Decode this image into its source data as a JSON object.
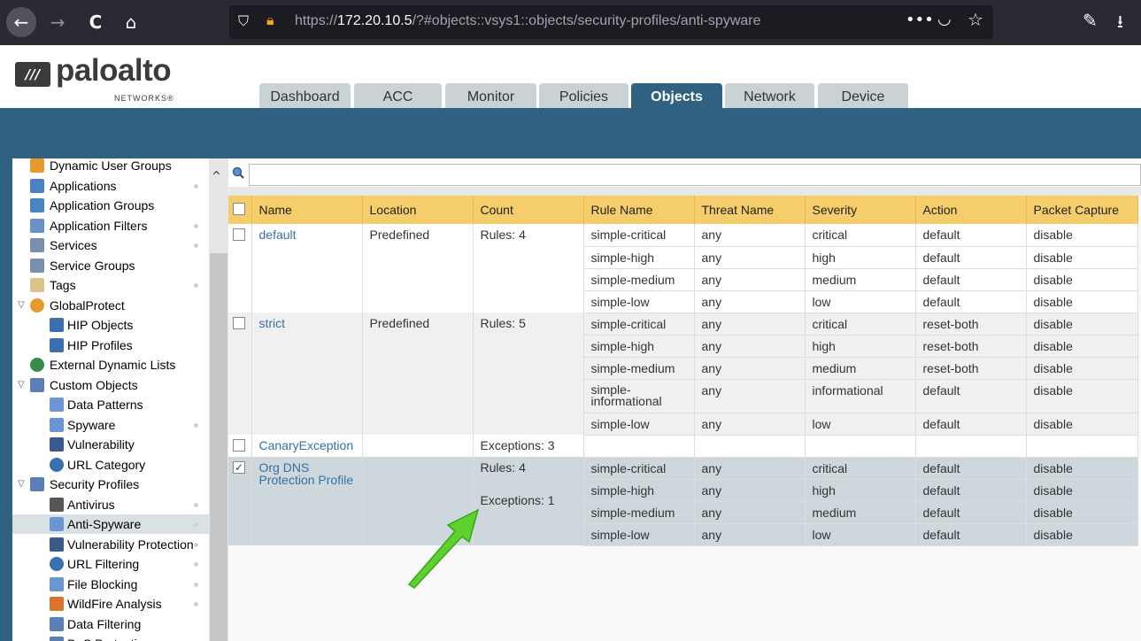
{
  "browser": {
    "back": "←",
    "forward": "→",
    "reload": "C",
    "home": "⌂",
    "url_prefix": "https://",
    "url_host": "172.20.10.5",
    "url_path": "/?#objects::vsys1::objects/security-profiles/anti-spyware",
    "more": "•••",
    "icons": [
      "back-icon",
      "forward-icon",
      "reload-icon",
      "home-icon",
      "shield-icon",
      "lock-icon",
      "pocket-icon",
      "star-icon",
      "wrench-icon",
      "download-icon"
    ]
  },
  "app": {
    "logo_text": "paloalto",
    "logo_sub": "NETWORKS®",
    "tabs": [
      "Dashboard",
      "ACC",
      "Monitor",
      "Policies",
      "Objects",
      "Network",
      "Device"
    ],
    "active_tab": "Objects"
  },
  "sidebar": {
    "items": [
      {
        "label": "Dynamic User Groups"
      },
      {
        "label": "Applications"
      },
      {
        "label": "Application Groups"
      },
      {
        "label": "Application Filters"
      },
      {
        "label": "Services"
      },
      {
        "label": "Service Groups"
      },
      {
        "label": "Tags"
      },
      {
        "label": "GlobalProtect"
      },
      {
        "label": "HIP Objects"
      },
      {
        "label": "HIP Profiles"
      },
      {
        "label": "External Dynamic Lists"
      },
      {
        "label": "Custom Objects"
      },
      {
        "label": "Data Patterns"
      },
      {
        "label": "Spyware"
      },
      {
        "label": "Vulnerability"
      },
      {
        "label": "URL Category"
      },
      {
        "label": "Security Profiles"
      },
      {
        "label": "Antivirus"
      },
      {
        "label": "Anti-Spyware"
      },
      {
        "label": "Vulnerability Protection"
      },
      {
        "label": "URL Filtering"
      },
      {
        "label": "File Blocking"
      },
      {
        "label": "WildFire Analysis"
      },
      {
        "label": "Data Filtering"
      },
      {
        "label": "DoS Protection"
      }
    ],
    "selected": "Anti-Spyware"
  },
  "table": {
    "columns": [
      "Name",
      "Location",
      "Count",
      "Rule Name",
      "Threat Name",
      "Severity",
      "Action",
      "Packet Capture"
    ],
    "profiles": [
      {
        "name": "default",
        "location": "Predefined",
        "count": [
          "Rules: 4"
        ],
        "checked": false,
        "rules": [
          [
            "simple-critical",
            "any",
            "critical",
            "default",
            "disable"
          ],
          [
            "simple-high",
            "any",
            "high",
            "default",
            "disable"
          ],
          [
            "simple-medium",
            "any",
            "medium",
            "default",
            "disable"
          ],
          [
            "simple-low",
            "any",
            "low",
            "default",
            "disable"
          ]
        ]
      },
      {
        "name": "strict",
        "location": "Predefined",
        "count": [
          "Rules: 5"
        ],
        "checked": false,
        "rules": [
          [
            "simple-critical",
            "any",
            "critical",
            "reset-both",
            "disable"
          ],
          [
            "simple-high",
            "any",
            "high",
            "reset-both",
            "disable"
          ],
          [
            "simple-medium",
            "any",
            "medium",
            "reset-both",
            "disable"
          ],
          [
            "simple-informational",
            "any",
            "informational",
            "default",
            "disable"
          ],
          [
            "simple-low",
            "any",
            "low",
            "default",
            "disable"
          ]
        ]
      },
      {
        "name": "CanaryException",
        "location": "",
        "count": [
          "Exceptions: 3"
        ],
        "checked": false,
        "rules": [
          [
            "",
            "",
            "",
            "",
            ""
          ]
        ]
      },
      {
        "name": "Org DNS Protection Profile",
        "location": "",
        "count": [
          "Rules: 4",
          "Exceptions: 1"
        ],
        "checked": true,
        "rules": [
          [
            "simple-critical",
            "any",
            "critical",
            "default",
            "disable"
          ],
          [
            "simple-high",
            "any",
            "high",
            "default",
            "disable"
          ],
          [
            "simple-medium",
            "any",
            "medium",
            "default",
            "disable"
          ],
          [
            "simple-low",
            "any",
            "low",
            "default",
            "disable"
          ]
        ]
      }
    ]
  },
  "colors": {
    "header_blue": "#306180",
    "table_header": "#f5cd6a",
    "selected_row": "#cdd7dc",
    "arrow": "#5fd12e"
  }
}
